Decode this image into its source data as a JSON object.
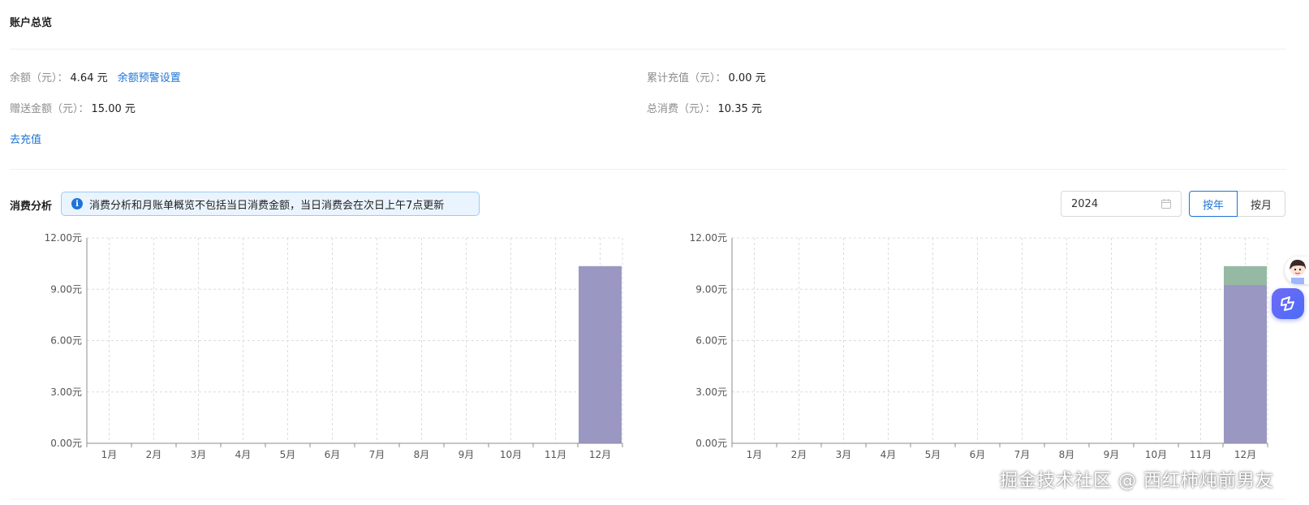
{
  "overview": {
    "title": "账户总览",
    "balance_label": "余额（元）：",
    "balance_value": "4.64 元",
    "balance_alert_link": "余额预警设置",
    "gift_label": "赠送金额（元）：",
    "gift_value": "15.00 元",
    "recharge_link": "去充值",
    "total_recharge_label": "累计充值（元）：",
    "total_recharge_value": "0.00 元",
    "total_spend_label": "总消费（元）：",
    "total_spend_value": "10.35 元"
  },
  "analysis": {
    "title": "消费分析",
    "notice": "消费分析和月账单概览不包括当日消费金额，当日消费会在次日上午7点更新",
    "year_value": "2024",
    "by_year_label": "按年",
    "by_month_label": "按月"
  },
  "watermark": "掘金技术社区 @ 西红柿炖前男友",
  "colors": {
    "accent": "#1e74d6",
    "bar_primary": "#9a98c2",
    "bar_secondary": "#96b9a3"
  },
  "chart_data": [
    {
      "type": "bar",
      "categories": [
        "1月",
        "2月",
        "3月",
        "4月",
        "5月",
        "6月",
        "7月",
        "8月",
        "9月",
        "10月",
        "11月",
        "12月"
      ],
      "series": [
        {
          "values": [
            0,
            0,
            0,
            0,
            0,
            0,
            0,
            0,
            0,
            0,
            0,
            10.35
          ],
          "color": "#9a98c2"
        }
      ],
      "yticks": [
        "0.00元",
        "3.00元",
        "6.00元",
        "9.00元",
        "12.00元"
      ],
      "ylim": [
        0,
        12
      ],
      "grid": true
    },
    {
      "type": "bar",
      "stacked": true,
      "categories": [
        "1月",
        "2月",
        "3月",
        "4月",
        "5月",
        "6月",
        "7月",
        "8月",
        "9月",
        "10月",
        "11月",
        "12月"
      ],
      "series": [
        {
          "values": [
            0,
            0,
            0,
            0,
            0,
            0,
            0,
            0,
            0,
            0,
            0,
            9.25
          ],
          "color": "#9a98c2"
        },
        {
          "values": [
            0,
            0,
            0,
            0,
            0,
            0,
            0,
            0,
            0,
            0,
            0,
            1.1
          ],
          "color": "#96b9a3"
        }
      ],
      "yticks": [
        "0.00元",
        "3.00元",
        "6.00元",
        "9.00元",
        "12.00元"
      ],
      "ylim": [
        0,
        12
      ],
      "grid": true
    }
  ]
}
